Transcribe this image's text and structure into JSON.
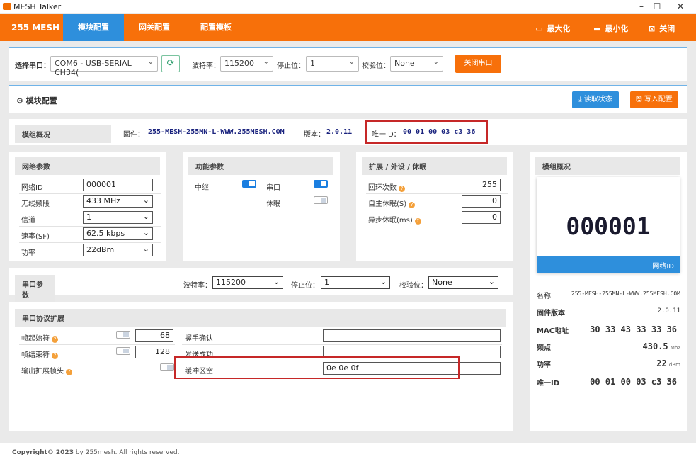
{
  "window": {
    "title": "MESH Talker",
    "min": "–",
    "max": "☐",
    "close": "✕"
  },
  "nav": {
    "brand": "255 MESH",
    "tabs": [
      "模块配置",
      "网关配置",
      "配置模板"
    ],
    "maximize": "最大化",
    "minimize": "最小化",
    "close": "关闭"
  },
  "serial_bar": {
    "port_label": "选择串口：",
    "port_value": "COM6 - USB-SERIAL CH34(",
    "baud_label": "波特率：",
    "baud_value": "115200",
    "stop_label": "停止位：",
    "stop_value": "1",
    "parity_label": "校验位：",
    "parity_value": "None",
    "close_port": "关闭串口"
  },
  "section": {
    "title": "模块配置",
    "read_status": "读取状态",
    "write_config": "写入配置"
  },
  "overview": {
    "label": "模组概况",
    "firmware_label": "固件：",
    "firmware": "255-MESH-255MN-L-WWW.255MESH.COM",
    "version_label": "版本：",
    "version": "2.0.11",
    "uid_label": "唯一ID：",
    "uid": "00 01 00 03 c3 36"
  },
  "network": {
    "header": "网络参数",
    "rows": [
      {
        "label": "网络ID",
        "value": "000001"
      },
      {
        "label": "无线频段",
        "value": "433 MHz"
      },
      {
        "label": "信道",
        "value": "1"
      },
      {
        "label": "速率(SF)",
        "value": "62.5 kbps"
      },
      {
        "label": "功率",
        "value": "22dBm"
      }
    ]
  },
  "function": {
    "header": "功能参数",
    "relay": "中继",
    "serial": "串口",
    "sleep": "休眠"
  },
  "extend": {
    "header": "扩展 / 外设 / 休眠",
    "rows": [
      {
        "label": "回环次数",
        "value": "255"
      },
      {
        "label": "自主休眠(S)",
        "value": "0"
      },
      {
        "label": "异步休眠(ms)",
        "value": "0"
      }
    ]
  },
  "serial_params": {
    "header": "串口参数",
    "baud_label": "波特率：",
    "baud_value": "115200",
    "stop_label": "停止位：",
    "stop_value": "1",
    "parity_label": "校验位：",
    "parity_value": "None"
  },
  "protocol": {
    "header": "串口协议扩展",
    "left_rows": [
      {
        "label": "帧起始符",
        "value": "68"
      },
      {
        "label": "帧结束符",
        "value": "128"
      },
      {
        "label": "输出扩展帧头",
        "value": ""
      }
    ],
    "right_rows": [
      {
        "label": "握手确认",
        "value": ""
      },
      {
        "label": "发送成功",
        "value": ""
      },
      {
        "label": "缓冲区空",
        "value": "0e 0e 0f"
      }
    ]
  },
  "side": {
    "header": "模组概况",
    "big_id": "000001",
    "card_caption": "网络ID",
    "rows": [
      {
        "label": "名称",
        "value": "255-MESH-255MN-L-WWW.255MESH.COM",
        "unit": ""
      },
      {
        "label": "固件版本",
        "value": "2.0.11",
        "unit": ""
      },
      {
        "label": "MAC地址",
        "value": "30 33 43 33 33 36",
        "unit": ""
      },
      {
        "label": "频点",
        "value": "430.5",
        "unit": "Mhz"
      },
      {
        "label": "功率",
        "value": "22",
        "unit": "dBm"
      },
      {
        "label": "唯一ID",
        "value": "00 01 00 03 c3 36",
        "unit": ""
      }
    ]
  },
  "footer": {
    "bold": "Copyright© 2023",
    "rest": " by 255mesh. All rights reserved."
  },
  "colors": {
    "orange": "#f7700a",
    "blue": "#2e8fdc",
    "highlight": "#c62828"
  }
}
